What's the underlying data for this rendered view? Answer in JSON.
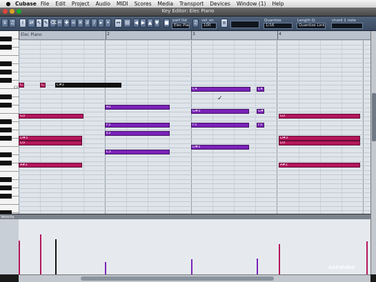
{
  "menubar": {
    "app": "Cubase",
    "items": [
      "File",
      "Edit",
      "Project",
      "Audio",
      "MIDI",
      "Scores",
      "Media",
      "Transport",
      "Devices",
      "Window (1)",
      "Help"
    ]
  },
  "window": {
    "title": "Key Editor: Elec Piano"
  },
  "toolbar": {
    "part_label": "part list",
    "part_value": "Elec Piano",
    "vel_label": "vel_on",
    "vel_value": "100",
    "quantize_label": "Quantize",
    "quantize_value": "1/16",
    "length_label": "Length Q.",
    "length_value": "Quantize Link",
    "chord_label": "chord 1 note"
  },
  "ruler": {
    "label": "Elec Piano",
    "bar_numbers": [
      "2",
      "3",
      "4"
    ]
  },
  "keyboard": {
    "label": "C3"
  },
  "notes": [
    {
      "label": "C3",
      "color": "#b4165c"
    },
    {
      "label": "C3",
      "color": "#b4165c"
    },
    {
      "label": "C#3",
      "color": "#111111"
    },
    {
      "label": "C4",
      "color": "#7a22b8"
    },
    {
      "label": "C4",
      "color": "#7a22b8"
    },
    {
      "label": "A3",
      "color": "#7a22b8"
    },
    {
      "label": "G#3",
      "color": "#7a22b8"
    },
    {
      "label": "G#3",
      "color": "#7a22b8"
    },
    {
      "label": "G3",
      "color": "#b4165c"
    },
    {
      "label": "G3",
      "color": "#b4165c"
    },
    {
      "label": "F3",
      "color": "#7a22b8"
    },
    {
      "label": "F3",
      "color": "#7a22b8"
    },
    {
      "label": "F3",
      "color": "#7a22b8"
    },
    {
      "label": "E3",
      "color": "#7a22b8"
    },
    {
      "label": "D#3",
      "color": "#b4165c"
    },
    {
      "label": "D3",
      "color": "#b4165c"
    },
    {
      "label": "D#3",
      "color": "#b4165c"
    },
    {
      "label": "D3",
      "color": "#b4165c"
    },
    {
      "label": "D#3",
      "color": "#7a22b8"
    },
    {
      "label": "C3",
      "color": "#7a22b8"
    },
    {
      "label": "A#2",
      "color": "#b4165c"
    },
    {
      "label": "A#2",
      "color": "#b4165c"
    }
  ],
  "velocity": {
    "label": "Velocity",
    "bars": [
      {
        "value": 82,
        "color": "#b4165c"
      },
      {
        "value": 97,
        "color": "#b4165c"
      },
      {
        "value": 85,
        "color": "#111111"
      },
      {
        "value": 30,
        "color": "#7a22b8"
      },
      {
        "value": 36,
        "color": "#7a22b8"
      },
      {
        "value": 38,
        "color": "#7a22b8"
      },
      {
        "value": 73,
        "color": "#b4165c"
      },
      {
        "value": 80,
        "color": "#b4165c"
      }
    ]
  },
  "watermark": "ASKVideo"
}
